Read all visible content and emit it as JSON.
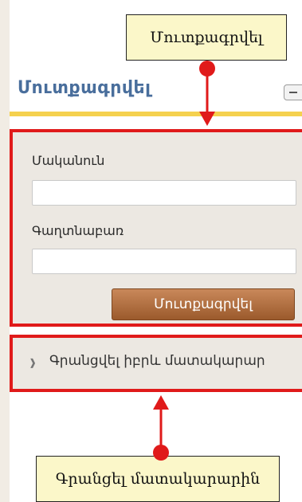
{
  "callouts": {
    "top_text": "Մուտքագրվել",
    "bottom_text": "Գրանցել մատակարարին"
  },
  "login": {
    "title": "Մուտքագրվել",
    "username_label": "Մականուն",
    "username_value": "",
    "password_label": "Գաղտնաբառ",
    "password_value": "",
    "submit_label": "Մուտքագրվել"
  },
  "guest": {
    "link_label": "Գրանցվել իբրև մատակարար"
  },
  "colors": {
    "highlight_border": "#e01a1a",
    "header_title": "#496e9c",
    "accent_rule": "#f5d14e",
    "button": "#b06d3f"
  },
  "icons": [
    "minus-icon",
    "chevron-right-icon",
    "arrow-down-icon",
    "arrow-up-icon"
  ]
}
